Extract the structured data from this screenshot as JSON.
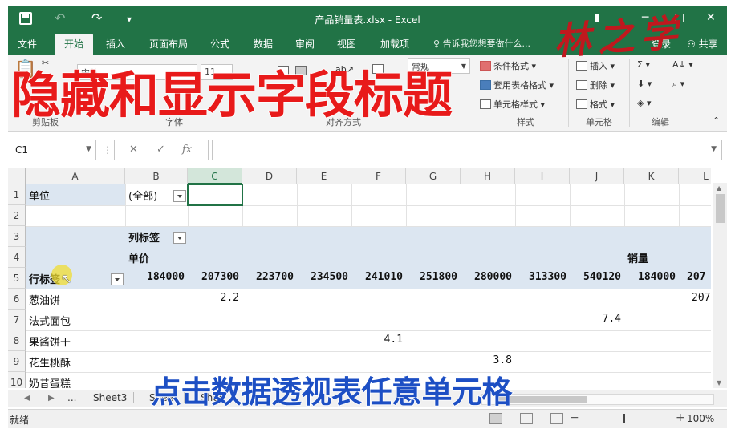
{
  "window": {
    "title": "产品销量表.xlsx - Excel",
    "controls": [
      "◧",
      "─",
      "□",
      "✕"
    ]
  },
  "tabs": [
    "文件",
    "开始",
    "插入",
    "页面布局",
    "公式",
    "数据",
    "审阅",
    "视图",
    "加载项"
  ],
  "active_tab": "开始",
  "tell_me": "告诉我您想要做什么...",
  "login": "登录",
  "share": "共享",
  "ribbon": {
    "font_name": "宋体",
    "font_size": "11",
    "number_format": "常规",
    "groups": {
      "clipboard": "剪贴板",
      "font": "字体",
      "alignment": "对齐方式",
      "styles": "样式",
      "cells": "单元格",
      "editing": "编辑"
    },
    "styles_items": [
      "条件格式",
      "套用表格格式",
      "单元格样式"
    ],
    "cells_items": [
      "插入",
      "删除",
      "格式"
    ]
  },
  "overlay_title": "隐藏和显示字段标题",
  "signature": "林之学",
  "formula_bar": {
    "name_box": "C1",
    "fx": "fx",
    "content": ""
  },
  "grid": {
    "columns": [
      "A",
      "B",
      "C",
      "D",
      "E",
      "F",
      "G",
      "H",
      "I",
      "J",
      "K",
      "L"
    ],
    "selected_column": "C",
    "rows": [
      "1",
      "2",
      "3",
      "4",
      "5",
      "6",
      "7",
      "8",
      "9",
      "10"
    ],
    "a1": "单位",
    "b1": "(全部)",
    "b3": "列标签",
    "b4": "单价",
    "k4": "销量",
    "a5": "行标签",
    "row5_values": [
      "184000",
      "207300",
      "223700",
      "234500",
      "241010",
      "251800",
      "280000",
      "313300",
      "540120",
      "184000",
      "207"
    ],
    "products": [
      "葱油饼",
      "法式面包",
      "果酱饼干",
      "花生桃酥",
      "奶昔蛋糕"
    ],
    "values": {
      "c6": "2.2",
      "l6": "207",
      "j7": "7.4",
      "f8": "4.1",
      "h9": "3.8"
    }
  },
  "sheet_tabs": [
    "...",
    "Sheet3",
    "Sheet",
    "Shee"
  ],
  "overlay_subtitle": "点击数据透视表任意单元格",
  "status": {
    "ready": "就绪",
    "zoom": "100%"
  }
}
